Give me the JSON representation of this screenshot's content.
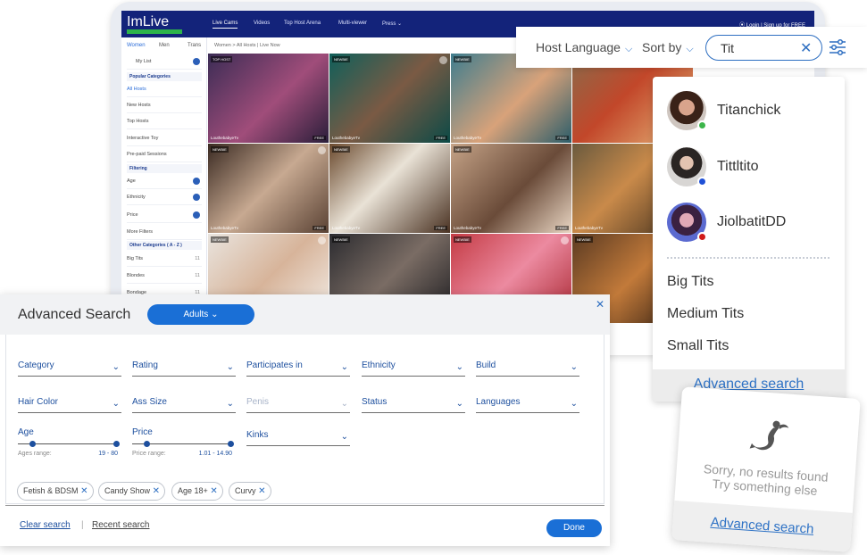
{
  "site": {
    "logo": "ImLive",
    "nav": [
      "Live Cams",
      "Videos",
      "Top Host Arena",
      "Multi-viewer",
      "Press ⌄"
    ],
    "login": "⦿ Login  |  Sign up for FREE",
    "gender_tabs": [
      "Women",
      "Men",
      "Trans"
    ],
    "breadcrumb": "Women  >  All Hosts  |  Live Now",
    "sidebar": {
      "mylist": "My List",
      "popular_heading": "Popular Categories",
      "popular": [
        "All Hosts",
        "New Hosts",
        "Top Hosts",
        "Interactive Toy",
        "Pre-paid Sessions"
      ],
      "filtering_heading": "Filtering",
      "filters": [
        "Age",
        "Ethnicity",
        "Price",
        "More Filters"
      ],
      "other_heading": "Other Categories  ( A - Z )",
      "other": [
        {
          "label": "Big Tits",
          "count": "11"
        },
        {
          "label": "Blondes",
          "count": "11"
        },
        {
          "label": "Bondage",
          "count": "11"
        }
      ]
    },
    "tiles": [
      {
        "badge": "TOP HOST",
        "name": "LouthebabyeTv"
      },
      {
        "badge": "NEWBIE",
        "name": "LouthebabyeTv"
      },
      {
        "badge": "NEWBIE",
        "name": "LouthebabyeTv"
      },
      {
        "badge": "",
        "name": ""
      },
      {
        "badge": "NEWBIE",
        "name": "LouthebabyeTv"
      },
      {
        "badge": "NEWBIE",
        "name": "LouthebabyeTv"
      },
      {
        "badge": "NEWBIE",
        "name": "LouthebabyeTv"
      },
      {
        "badge": "",
        "name": "LouthebabyeTv"
      },
      {
        "badge": "NEWBIE",
        "name": ""
      },
      {
        "badge": "NEWBIE",
        "name": ""
      },
      {
        "badge": "NEWBIE",
        "name": ""
      },
      {
        "badge": "NEWBIE",
        "name": ""
      }
    ],
    "free_label": "FREE"
  },
  "searchbar": {
    "host_language": "Host Language",
    "sort_by": "Sort by",
    "query": "Tit",
    "clear": "✕"
  },
  "suggestions": {
    "users": [
      {
        "name": "Titanchick",
        "status_color": "#3cb54a"
      },
      {
        "name": "Tittltito",
        "status_color": "#1f50d6"
      },
      {
        "name": "JiolbatitDD",
        "status_color": "#d11a1a"
      }
    ],
    "categories": [
      "Big Tits",
      "Medium Tits",
      "Small Tits"
    ],
    "advanced_link": "Advanced search"
  },
  "no_results": {
    "line1": "Sorry, no results found",
    "line2": "Try something else",
    "advanced_link": "Advanced search"
  },
  "advanced": {
    "title": "Advanced Search",
    "audience": "Adults",
    "close": "✕",
    "fields_row1": [
      "Category",
      "Rating",
      "Participates in",
      "Ethnicity",
      "Build"
    ],
    "fields_row2": [
      "Hair Color",
      "Ass Size",
      "Penis",
      "Status",
      "Languages"
    ],
    "age": {
      "label": "Age",
      "caption": "Ages range:",
      "value": "19 - 80",
      "min": 19,
      "max": 80
    },
    "price": {
      "label": "Price",
      "caption": "Price range:",
      "value": "1.01 - 14.90",
      "min": 1.01,
      "max": 14.9
    },
    "kinks": "Kinks",
    "chips": [
      "Fetish & BDSM",
      "Candy Show",
      "Age 18+",
      "Curvy"
    ],
    "clear": "Clear search",
    "recent": "Recent search",
    "done": "Done"
  }
}
